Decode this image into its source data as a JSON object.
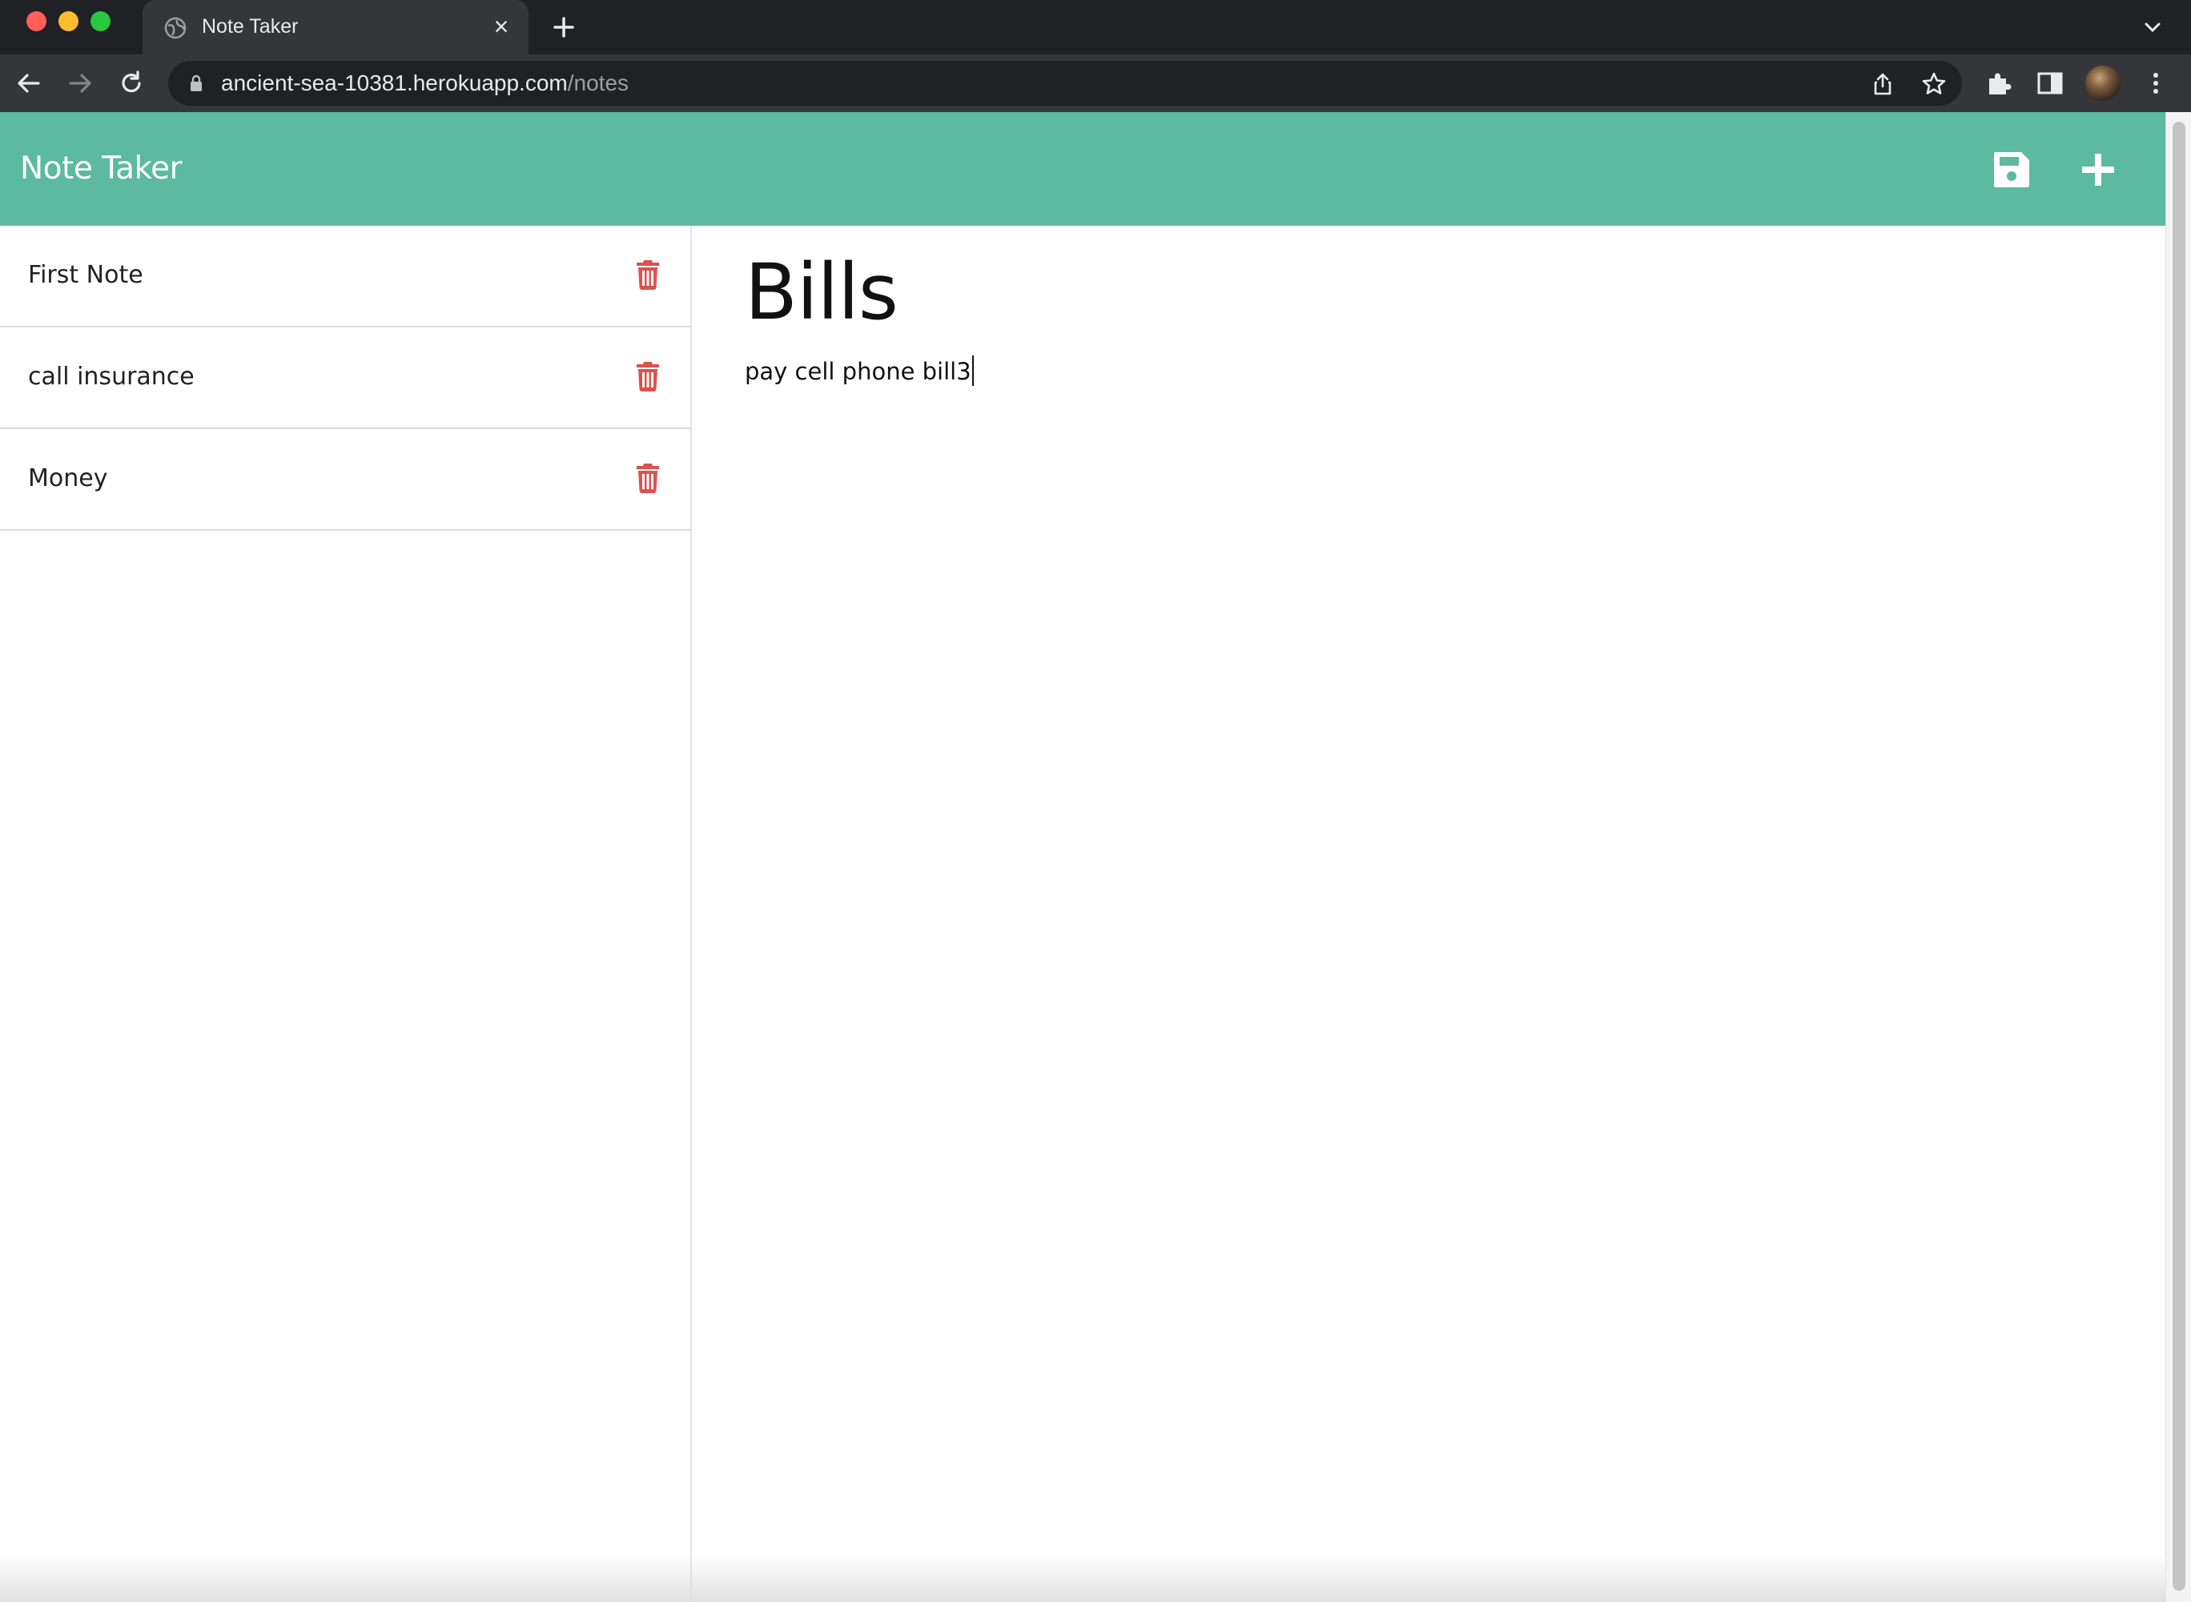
{
  "browser": {
    "tab_title": "Note Taker",
    "url_host": "ancient-sea-10381.herokuapp.com",
    "url_path": "/notes"
  },
  "app": {
    "brand": "Note Taker",
    "accent_color": "#5bba9f",
    "delete_color": "#d9534f"
  },
  "notes": [
    {
      "title": "First Note"
    },
    {
      "title": "call insurance"
    },
    {
      "title": "Money"
    }
  ],
  "active_note": {
    "title": "Bills",
    "text": "pay cell phone bill3"
  }
}
